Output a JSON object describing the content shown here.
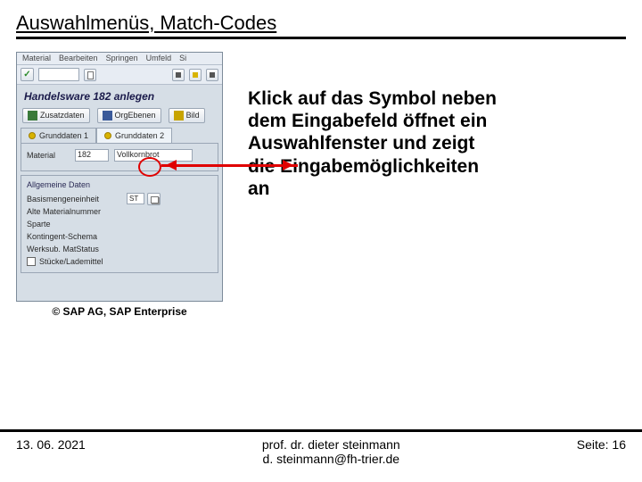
{
  "title": "Auswahlmenüs, Match-Codes",
  "sap": {
    "menu": [
      "Material",
      "Bearbeiten",
      "Springen",
      "Umfeld",
      "Si"
    ],
    "header": "Handelsware 182 anlegen",
    "toolbar2": [
      {
        "icon": "ig",
        "label": "Zusatzdaten"
      },
      {
        "icon": "ib",
        "label": "OrgEbenen"
      },
      {
        "icon": "iy",
        "label": "Bild"
      }
    ],
    "tab1": "Grunddaten 1",
    "tab2": "Grunddaten 2",
    "field_material_label": "Material",
    "field_material_value": "182",
    "field_material_desc": "Vollkornbrot",
    "group_header": "Allgemeine Daten",
    "lines": [
      {
        "label": "Basismengeneinheit",
        "match": true,
        "value": "ST"
      },
      {
        "label": "Alte Materialnummer"
      },
      {
        "label": "Sparte"
      },
      {
        "label": "Kontingent-Schema"
      },
      {
        "label": "Werksub. MatStatus"
      }
    ],
    "checkbox_label": "Stücke/Lademittel"
  },
  "caption": "© SAP AG, SAP Enterprise",
  "explanation": "Klick auf das Symbol neben dem Eingabefeld öffnet ein Auswahlfenster und zeigt die Eingabemöglichkeiten an",
  "footer": {
    "date": "13. 06. 2021",
    "author1": "prof. dr. dieter steinmann",
    "author2": "d. steinmann@fh-trier.de",
    "page": "Seite: 16"
  }
}
